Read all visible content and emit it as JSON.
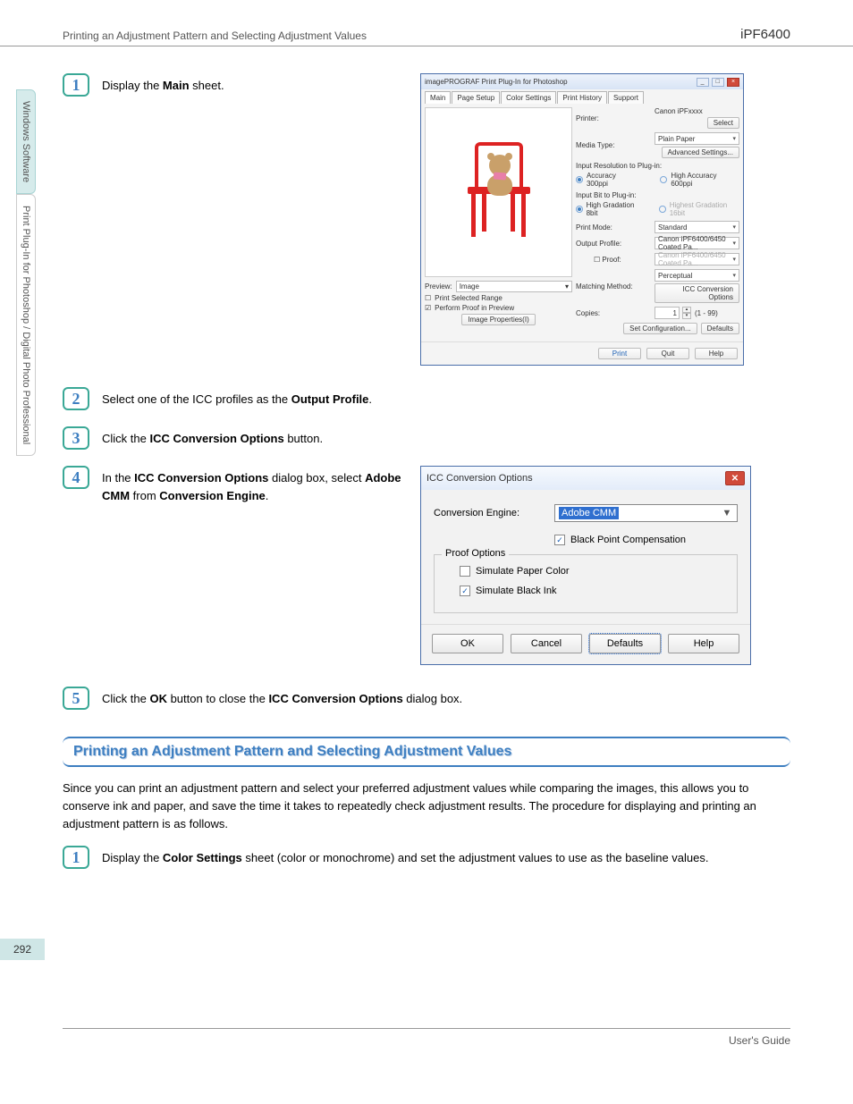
{
  "header": {
    "left": "Printing an Adjustment Pattern and Selecting Adjustment Values",
    "right": "iPF6400"
  },
  "side_tabs": {
    "tab1": "Windows Software",
    "tab2": "Print Plug-In for Photoshop / Digital Photo Professional"
  },
  "steps": {
    "s1_num": "1",
    "s1_a": "Display the ",
    "s1_b": "Main",
    "s1_c": " sheet.",
    "s2_num": "2",
    "s2_a": "Select one of the ICC profiles as the ",
    "s2_b": "Output Profile",
    "s2_c": ".",
    "s3_num": "3",
    "s3_a": "Click the ",
    "s3_b": "ICC Conversion Options",
    "s3_c": " button.",
    "s4_num": "4",
    "s4_a": "In the ",
    "s4_b": "ICC Conversion Options",
    "s4_c": " dialog box, select ",
    "s4_d": "Adobe CMM",
    "s4_e": " from ",
    "s4_f": "Conversion Engine",
    "s4_g": ".",
    "s5_num": "5",
    "s5_a": "Click the ",
    "s5_b": "OK",
    "s5_c": " button to close the ",
    "s5_d": "ICC Conversion Options",
    "s5_e": " dialog box."
  },
  "section_title": "Printing an Adjustment Pattern and Selecting Adjustment Values",
  "section_para": "Since you can print an adjustment pattern and select your preferred adjustment values while comparing the images, this allows you to conserve ink and paper, and save the time it takes to repeatedly check adjustment results. The procedure for displaying and printing an adjustment pattern is as follows.",
  "sec_step1_num": "1",
  "sec_step1_a": "Display the ",
  "sec_step1_b": "Color Settings",
  "sec_step1_c": " sheet (color or monochrome) and set the adjustment values to use as the baseline values.",
  "page_number": "292",
  "footer_text": "User's Guide",
  "shot1": {
    "title": "imagePROGRAF Print Plug-In for Photoshop",
    "tabs": {
      "t1": "Main",
      "t2": "Page Setup",
      "t3": "Color Settings",
      "t4": "Print History",
      "t5": "Support"
    },
    "preview_label": "Preview:",
    "preview_value": "Image",
    "chk1": "Print Selected Range",
    "chk2": "Perform Proof in Preview",
    "btn_imgprops": "Image Properties(I)",
    "lbl_printer": "Printer:",
    "val_printer": "Canon iPFxxxx",
    "btn_select": "Select",
    "lbl_media": "Media Type:",
    "val_media": "Plain Paper",
    "btn_advset": "Advanced Settings...",
    "lbl_inputres": "Input Resolution to Plug-in:",
    "r_acc300": "Accuracy 300ppi",
    "r_acc600": "High Accuracy 600ppi",
    "lbl_inputbit": "Input Bit to Plug-in:",
    "r_grad8": "High Gradation 8bit",
    "r_grad16": "Highest Gradation 16bit",
    "lbl_printmode": "Print Mode:",
    "val_printmode": "Standard",
    "lbl_outprof": "Output Profile:",
    "val_outprof": "Canon iPF6400/6450 Coated Pa...",
    "chk_proof": "Proof:",
    "val_proof": "Canon iPF6400/6450 Coated Pa...",
    "lbl_matching": "Matching Method:",
    "val_matching": "Perceptual",
    "btn_iccopts": "ICC Conversion Options",
    "lbl_copies": "Copies:",
    "val_copies": "1",
    "copies_range": "(1 - 99)",
    "btn_setconf": "Set Configuration...",
    "btn_defaults": "Defaults",
    "btn_print": "Print",
    "btn_quit": "Quit",
    "btn_help": "Help"
  },
  "shot2": {
    "title": "ICC Conversion Options",
    "lbl_engine": "Conversion Engine:",
    "val_engine": "Adobe CMM",
    "chk_bpc": "Black Point Compensation",
    "legend": "Proof Options",
    "chk_paper": "Simulate Paper Color",
    "chk_ink": "Simulate Black Ink",
    "btn_ok": "OK",
    "btn_cancel": "Cancel",
    "btn_defaults": "Defaults",
    "btn_help": "Help"
  }
}
